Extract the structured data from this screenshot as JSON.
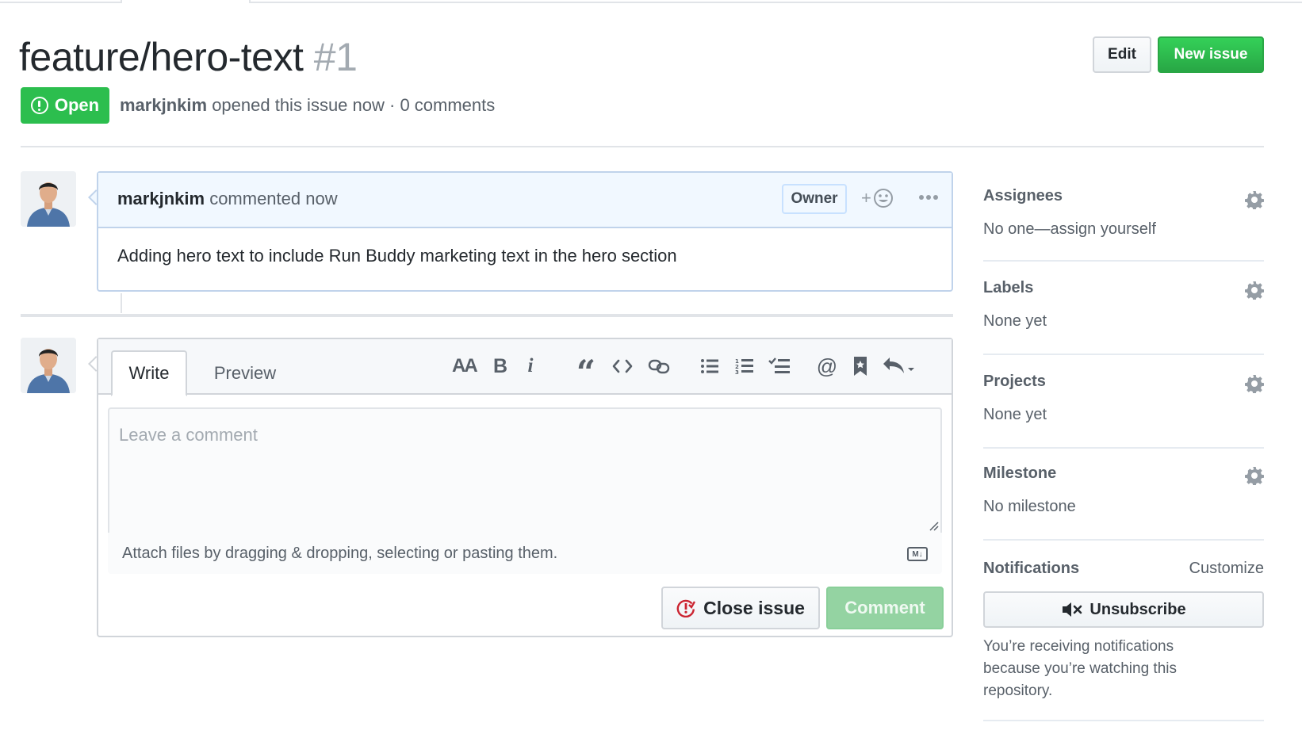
{
  "issue": {
    "title": "feature/hero-text",
    "number": "#1",
    "state": "Open",
    "author": "markjnkim",
    "meta_text": "opened this issue now · 0 comments"
  },
  "header_actions": {
    "edit_label": "Edit",
    "new_issue_label": "New issue"
  },
  "comment": {
    "author": "markjnkim",
    "action_text": "commented now",
    "role_badge": "Owner",
    "reaction_label": "+",
    "body": "Adding hero text to include Run Buddy marketing text in the hero section"
  },
  "new_comment": {
    "tabs": [
      "Write",
      "Preview"
    ],
    "toolbar": [
      "heading-icon",
      "bold-icon",
      "italic-icon",
      "quote-icon",
      "code-icon",
      "link-icon",
      "bullet-list-icon",
      "numbered-list-icon",
      "task-list-icon",
      "mention-icon",
      "saved-reply-icon",
      "reply-icon"
    ],
    "toolbar_text": {
      "heading": "AA",
      "bold": "B",
      "italic": "i",
      "quote": "“",
      "mention": "@"
    },
    "placeholder": "Leave a comment",
    "attach_text": "Attach files by dragging & dropping, selecting or pasting them.",
    "markdown_badge": "M↓",
    "close_label": "Close issue",
    "comment_label": "Comment"
  },
  "sidebar": {
    "assignees": {
      "title": "Assignees",
      "value": "No one—assign yourself"
    },
    "labels": {
      "title": "Labels",
      "value": "None yet"
    },
    "projects": {
      "title": "Projects",
      "value": "None yet"
    },
    "milestone": {
      "title": "Milestone",
      "value": "No milestone"
    },
    "notifications": {
      "title": "Notifications",
      "customize": "Customize",
      "unsubscribe_label": "Unsubscribe",
      "info": "You’re receiving notifications because you’re watching this repository."
    }
  },
  "colors": {
    "open_green": "#2cbe4e",
    "primary_green": "#28a745",
    "danger_red": "#cb2431",
    "comment_head_bg": "#f1f8ff"
  }
}
